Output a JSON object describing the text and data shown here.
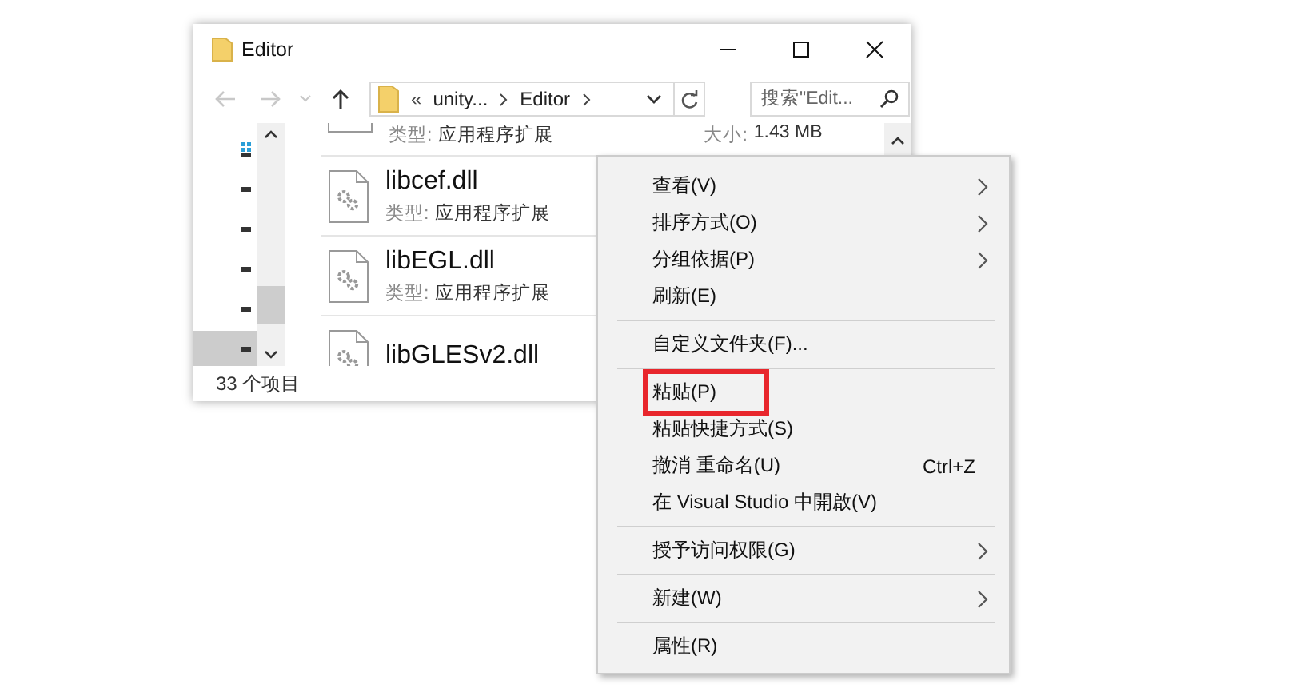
{
  "window": {
    "title": "Editor"
  },
  "navigation": {
    "back_disabled": true,
    "forward_disabled": true,
    "address_prefix": "«",
    "breadcrumbs": [
      "unity...",
      "Editor"
    ],
    "search": {
      "placeholder": "搜索\"Edit..."
    }
  },
  "nav_pane": {
    "items": [
      {
        "selected": false
      },
      {
        "selected": false
      },
      {
        "selected": false
      },
      {
        "selected": false
      },
      {
        "selected": false
      },
      {
        "selected": true
      }
    ]
  },
  "files": [
    {
      "type_label": "类型:",
      "type": "应用程序扩展",
      "size_label": "大小:",
      "size": "1.43 MB"
    },
    {
      "name": "libcef.dll",
      "type_label": "类型:",
      "type": "应用程序扩展"
    },
    {
      "name": "libEGL.dll",
      "type_label": "类型:",
      "type": "应用程序扩展"
    },
    {
      "name": "libGLESv2.dll"
    }
  ],
  "status_bar": {
    "item_count": "33 个项目"
  },
  "context_menu": {
    "groups": [
      [
        {
          "label": "查看(V)",
          "submenu": true,
          "highlighted": false
        },
        {
          "label": "排序方式(O)",
          "submenu": true,
          "highlighted": false
        },
        {
          "label": "分组依据(P)",
          "submenu": true,
          "highlighted": false
        },
        {
          "label": "刷新(E)",
          "submenu": false,
          "highlighted": false
        }
      ],
      [
        {
          "label": "自定义文件夹(F)...",
          "submenu": false,
          "highlighted": false
        }
      ],
      [
        {
          "label": "粘贴(P)",
          "submenu": false,
          "highlighted": true
        },
        {
          "label": "粘贴快捷方式(S)",
          "submenu": false,
          "highlighted": false
        },
        {
          "label": "撤消 重命名(U)",
          "shortcut": "Ctrl+Z",
          "submenu": false,
          "highlighted": false
        },
        {
          "label": "在 Visual Studio 中開啟(V)",
          "submenu": false,
          "highlighted": false
        }
      ],
      [
        {
          "label": "授予访问权限(G)",
          "submenu": true,
          "highlighted": false
        }
      ],
      [
        {
          "label": "新建(W)",
          "submenu": true,
          "highlighted": false
        }
      ],
      [
        {
          "label": "属性(R)",
          "submenu": false,
          "highlighted": false
        }
      ]
    ]
  }
}
